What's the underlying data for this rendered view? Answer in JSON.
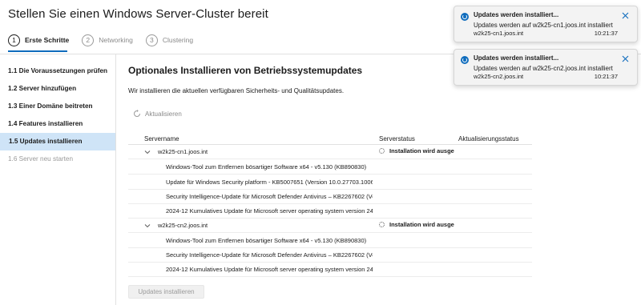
{
  "title": "Stellen Sie einen Windows Server-Cluster bereit",
  "steps": [
    {
      "num": "1",
      "label": "Erste Schritte"
    },
    {
      "num": "2",
      "label": "Networking"
    },
    {
      "num": "3",
      "label": "Clustering"
    }
  ],
  "sidebar": {
    "items": [
      {
        "label": "1.1  Die Voraussetzungen prüfen"
      },
      {
        "label": "1.2  Server hinzufügen"
      },
      {
        "label": "1.3  Einer Domäne beitreten"
      },
      {
        "label": "1.4  Features installieren"
      },
      {
        "label": "1.5  Updates installieren"
      },
      {
        "label": "1.6  Server neu starten"
      }
    ]
  },
  "content": {
    "title": "Optionales Installieren von Betriebssystemupdates",
    "description": "Wir installieren die aktuellen verfügbaren Sicherheits- und Qualitätsupdates.",
    "refresh_label": "Aktualisieren"
  },
  "table": {
    "columns": [
      "Servername",
      "Serverstatus",
      "Aktualisierungsstatus"
    ],
    "servers": [
      {
        "name": "w2k25-cn1.joos.int",
        "status": "Installation wird ausgeführt",
        "updates": [
          "Windows-Tool zum Entfernen bösartiger Software x64 - v5.130 (KB890830)",
          "Update für Windows Security platform - KB5007651 (Version 10.0.27703.1006)",
          "Security Intelligence-Update für Microsoft Defender Antivirus – KB2267602 (Ve...",
          "2024-12 Kumulatives Update für Microsoft server operating system version 24..."
        ]
      },
      {
        "name": "w2k25-cn2.joos.int",
        "status": "Installation wird ausgeführt",
        "updates": [
          "Windows-Tool zum Entfernen bösartiger Software x64 - v5.130 (KB890830)",
          "Security Intelligence-Update für Microsoft Defender Antivirus – KB2267602 (Ve...",
          "2024-12 Kumulatives Update für Microsoft server operating system version 24..."
        ]
      }
    ]
  },
  "install_button_label": "Updates installieren",
  "notifications": [
    {
      "title": "Updates werden installiert...",
      "message": "Updates werden auf w2k25-cn1.joos.int installiert",
      "server": "w2k25-cn1.joos.int",
      "time": "10:21:37"
    },
    {
      "title": "Updates werden installiert...",
      "message": "Updates werden auf w2k25-cn2.joos.int installiert",
      "server": "w2k25-cn2.joos.int",
      "time": "10:21:37"
    }
  ],
  "colors": {
    "accent": "#0f6cbd",
    "selected_bg": "#cfe4f7"
  }
}
